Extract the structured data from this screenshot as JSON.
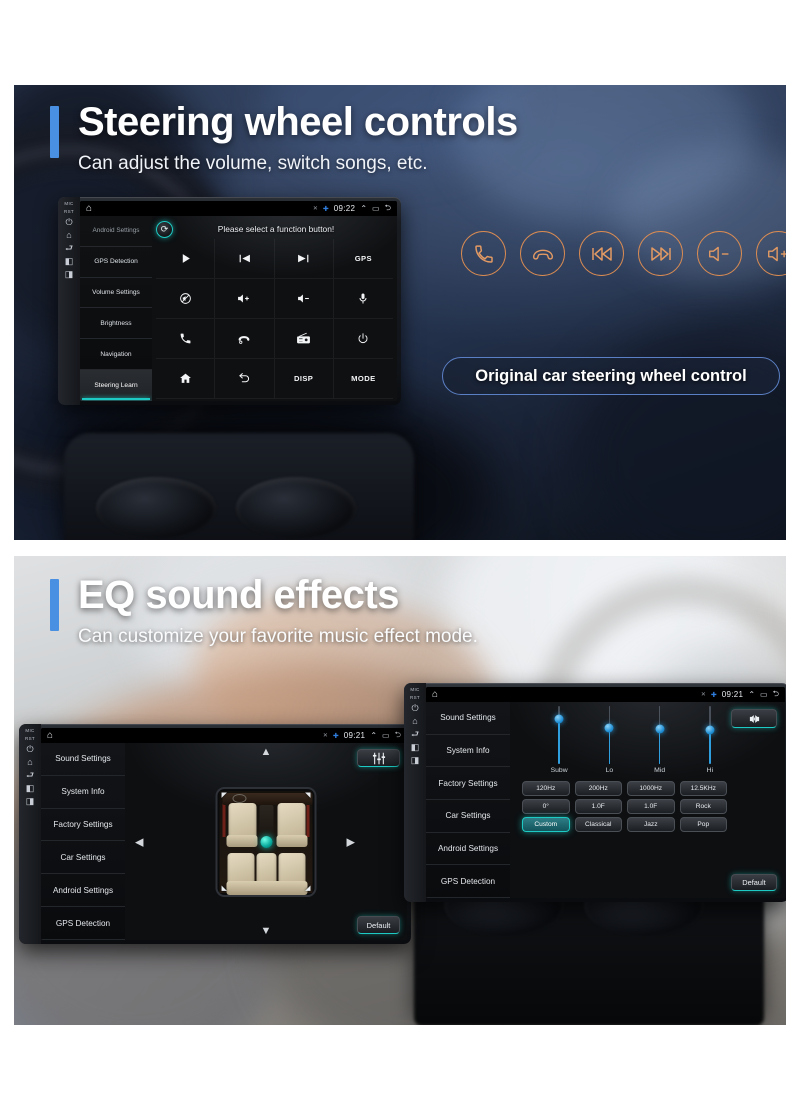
{
  "panels": [
    {
      "id": "steering-wheel-controls",
      "heading": "Steering wheel controls",
      "subheading": "Can adjust the volume, switch songs, etc.",
      "accent_color": "#4a90e2",
      "caption": "Original car steering wheel control",
      "caption_border_color": "#5b7fc4",
      "orange_icon_color": "#d98b52",
      "orange_icons": [
        {
          "name": "phone-call-icon",
          "label": "Answer call"
        },
        {
          "name": "phone-hangup-icon",
          "label": "End call"
        },
        {
          "name": "previous-track-icon",
          "label": "Previous track"
        },
        {
          "name": "next-track-icon",
          "label": "Next track"
        },
        {
          "name": "volume-down-icon",
          "label": "Volume down"
        },
        {
          "name": "volume-up-icon",
          "label": "Volume up"
        }
      ],
      "head_unit": {
        "bezel_buttons": [
          "MIC",
          "RST",
          "power-icon",
          "home-icon",
          "back-icon",
          "volume-up-icon",
          "volume-down-icon"
        ],
        "status_bar": {
          "home_icon": "home-icon",
          "mute_icon": "mute-icon",
          "bluetooth_icon": "bluetooth-icon",
          "clock": "09:22",
          "expand_icon": "chevron-up-icon",
          "recents_icon": "recents-icon",
          "back_icon": "back-icon"
        },
        "sidebar": [
          {
            "label": "Android Settings",
            "selected": false,
            "clipped": true
          },
          {
            "label": "GPS Detection",
            "selected": false
          },
          {
            "label": "Volume Settings",
            "selected": false
          },
          {
            "label": "Brightness",
            "selected": false
          },
          {
            "label": "Navigation",
            "selected": false
          },
          {
            "label": "Steering Learn",
            "selected": true
          }
        ],
        "prompt": "Please select a function button!",
        "refresh_button": "refresh-icon",
        "function_buttons": [
          {
            "name": "play-button",
            "icon": "play",
            "text": ""
          },
          {
            "name": "previous-button",
            "icon": "prev",
            "text": ""
          },
          {
            "name": "next-button",
            "icon": "next",
            "text": ""
          },
          {
            "name": "gps-button",
            "icon": "text",
            "text": "GPS"
          },
          {
            "name": "mute-button",
            "icon": "mute",
            "text": ""
          },
          {
            "name": "volume-up-button",
            "icon": "volup",
            "text": ""
          },
          {
            "name": "volume-down-button",
            "icon": "voldown",
            "text": ""
          },
          {
            "name": "voice-button",
            "icon": "mic",
            "text": ""
          },
          {
            "name": "call-button",
            "icon": "call",
            "text": ""
          },
          {
            "name": "hangup-button",
            "icon": "hangup",
            "text": ""
          },
          {
            "name": "radio-button",
            "icon": "radio",
            "text": ""
          },
          {
            "name": "power-button",
            "icon": "power",
            "text": ""
          },
          {
            "name": "home-button",
            "icon": "home",
            "text": ""
          },
          {
            "name": "back-button",
            "icon": "back",
            "text": ""
          },
          {
            "name": "disp-button",
            "icon": "text",
            "text": "DISP"
          },
          {
            "name": "mode-button",
            "icon": "text",
            "text": "MODE"
          }
        ]
      }
    },
    {
      "id": "eq-sound-effects",
      "heading": "EQ sound effects",
      "subheading": "Can customize your favorite music effect mode.",
      "accent_color": "#4a90e2",
      "sound_field_unit": {
        "status_bar": {
          "clock": "09:21"
        },
        "sidebar": [
          "Sound Settings",
          "System Info",
          "Factory Settings",
          "Car Settings",
          "Android Settings",
          "GPS Detection"
        ],
        "eq_toggle_button": "equalizer-icon",
        "default_button": "Default",
        "arrows": [
          "up",
          "down",
          "left",
          "right"
        ],
        "position_marker": "green-balance-dot"
      },
      "eq_unit": {
        "status_bar": {
          "clock": "09:21"
        },
        "sidebar": [
          "Sound Settings",
          "System Info",
          "Factory Settings",
          "Car Settings",
          "Android Settings",
          "GPS Detection"
        ],
        "balance_toggle_button": "sound-field-icon",
        "default_button": "Default",
        "sliders": [
          {
            "label": "Subw",
            "value": 78
          },
          {
            "label": "Lo",
            "value": 62
          },
          {
            "label": "Mid",
            "value": 60
          },
          {
            "label": "Hi",
            "value": 58
          }
        ],
        "value_buttons_row1": [
          "120Hz",
          "200Hz",
          "1000Hz",
          "12.5KHz"
        ],
        "value_buttons_row2": [
          "0°",
          "1.0F",
          "1.0F",
          "Rock"
        ],
        "preset_buttons": [
          {
            "label": "Custom",
            "active": true
          },
          {
            "label": "Classical",
            "active": false
          },
          {
            "label": "Jazz",
            "active": false
          },
          {
            "label": "Pop",
            "active": false
          }
        ]
      }
    }
  ]
}
